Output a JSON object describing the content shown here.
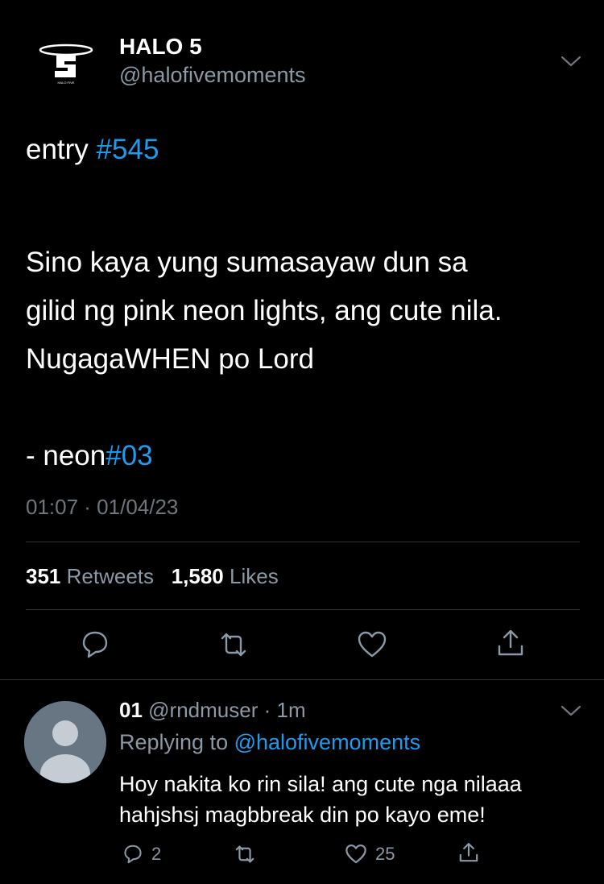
{
  "tweet": {
    "display_name": "HALO 5",
    "handle": "@halofivemoments",
    "logo_text": "HALO FIVE",
    "text_entry": "entry ",
    "hashtag_entry": "#545",
    "text_body_1": "Sino kaya yung sumasayaw dun sa",
    "text_body_2": "gilid ng pink neon lights, ang cute nila.",
    "text_body_3": "NugagaWHEN po Lord",
    "text_sign": "- neon",
    "hashtag_sign": "#03",
    "timestamp": "01:07 · 01/04/23",
    "retweets_count": "351",
    "retweets_label": "Retweets",
    "likes_count": "1,580",
    "likes_label": "Likes"
  },
  "reply": {
    "display_name": "01",
    "handle": "@rndmuser",
    "time": "· 1m",
    "replying_prefix": "Replying to ",
    "replying_handle": "@halofivemoments",
    "text_line_1": "Hoy nakita ko rin sila! ang cute nga nilaaa",
    "text_line_2": "hahjshsj magbbreak din po kayo eme!",
    "reply_count": "2",
    "like_count": "25"
  },
  "colors": {
    "background": "#000000",
    "link": "#1d9bf0",
    "muted": "#8b98a5",
    "divider": "#2f3336"
  },
  "icons": [
    "halo-logo-icon",
    "chevron-down-icon",
    "reply-icon",
    "retweet-icon",
    "like-icon",
    "share-icon",
    "default-avatar-icon"
  ]
}
